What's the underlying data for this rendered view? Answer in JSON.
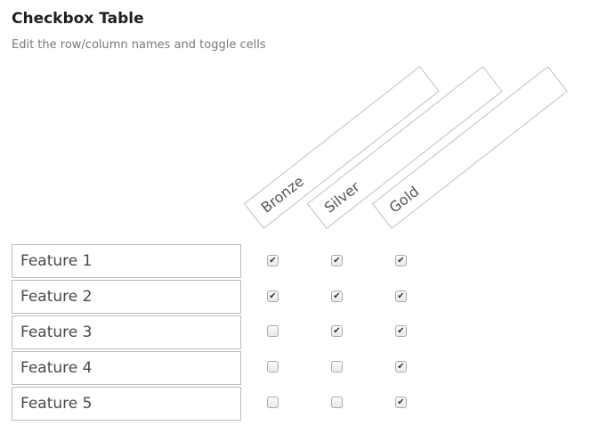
{
  "header": {
    "title": "Checkbox Table",
    "subtitle": "Edit the row/column names and toggle cells"
  },
  "columns": [
    {
      "label": "Bronze"
    },
    {
      "label": "Silver"
    },
    {
      "label": "Gold"
    }
  ],
  "rows": [
    {
      "label": "Feature 1",
      "cells": [
        true,
        true,
        true
      ]
    },
    {
      "label": "Feature 2",
      "cells": [
        true,
        true,
        true
      ]
    },
    {
      "label": "Feature 3",
      "cells": [
        false,
        true,
        true
      ]
    },
    {
      "label": "Feature 4",
      "cells": [
        false,
        false,
        true
      ]
    },
    {
      "label": "Feature 5",
      "cells": [
        false,
        false,
        true
      ]
    }
  ],
  "check_glyph": "✔"
}
